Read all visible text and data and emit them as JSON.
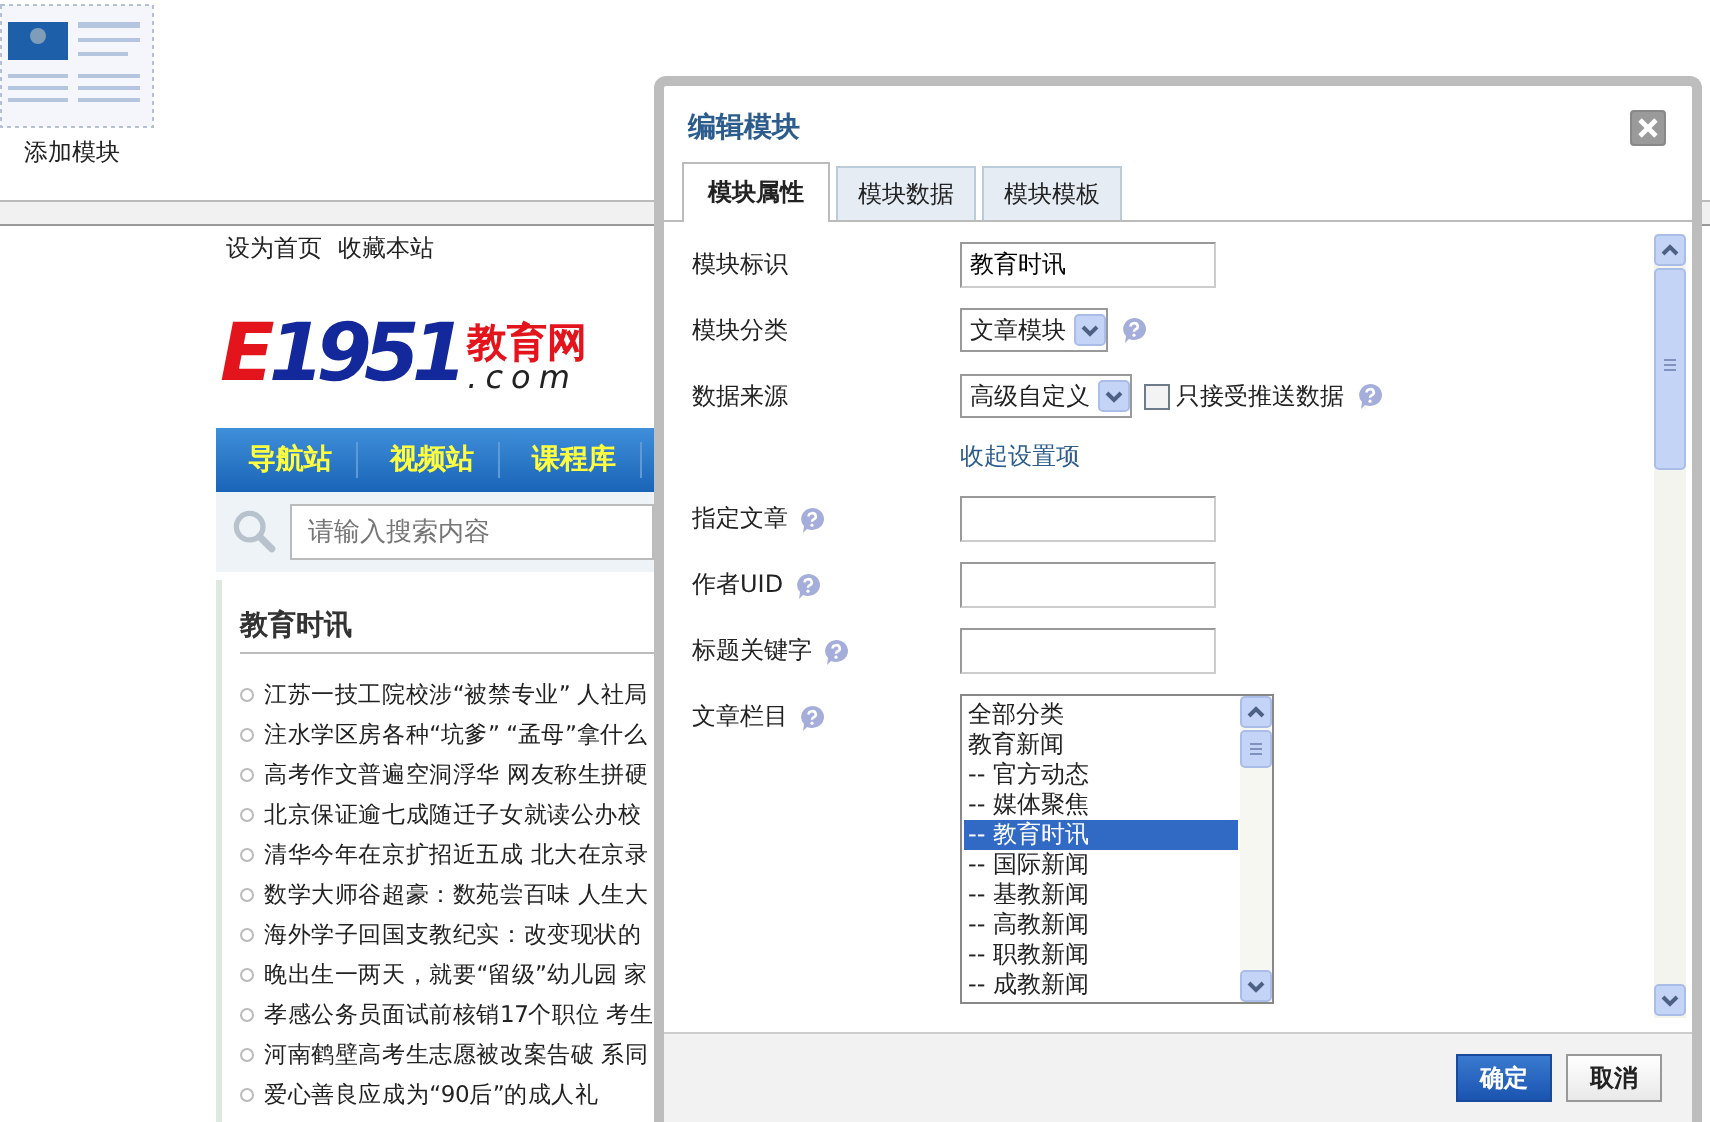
{
  "module_palette": {
    "label": "添加模块"
  },
  "site": {
    "top_links": [
      "设为首页",
      "收藏本站"
    ],
    "logo": {
      "letter": "E",
      "number": "1951",
      "name": "教育网",
      "domain": ".com"
    },
    "nav": [
      "导航站",
      "视频站",
      "课程库"
    ],
    "search": {
      "placeholder": "请输入搜索内容"
    },
    "news": {
      "title": "教育时讯",
      "items": [
        "江苏一技工院校涉“被禁专业” 人社局",
        "注水学区房各种“坑爹” “孟母”拿什么",
        "高考作文普遍空洞浮华 网友称生拼硬",
        "北京保证逾七成随迁子女就读公办校",
        "清华今年在京扩招近五成 北大在京录",
        "数学大师谷超豪：数苑尝百味 人生大",
        "海外学子回国支教纪实：改变现状的",
        "晚出生一两天，就要“留级”幼儿园 家",
        "孝感公务员面试前核销17个职位 考生",
        "河南鹤壁高考生志愿被改案告破 系同",
        "爱心善良应成为“90后”的成人礼"
      ]
    }
  },
  "dialog": {
    "title": "编辑模块",
    "tabs": [
      {
        "label": "模块属性",
        "selected": true
      },
      {
        "label": "模块数据",
        "selected": false
      },
      {
        "label": "模块模板",
        "selected": false
      }
    ],
    "fields": [
      {
        "kind": "text",
        "label": "模块标识",
        "value": "教育时讯",
        "help": false
      },
      {
        "kind": "select",
        "label": "模块分类",
        "value": "文章模块",
        "help": true
      },
      {
        "kind": "select",
        "label": "数据来源",
        "value": "高级自定义",
        "checkbox": {
          "label": "只接受推送数据",
          "checked": false
        },
        "help": true
      },
      {
        "kind": "link",
        "label": "收起设置项"
      },
      {
        "kind": "text",
        "label": "指定文章",
        "help": true
      },
      {
        "kind": "text",
        "label": "作者UID",
        "help": true
      },
      {
        "kind": "text",
        "label": "标题关键字",
        "help": true
      },
      {
        "kind": "list",
        "label": "文章栏目",
        "help": true,
        "options": [
          {
            "label": "全部分类",
            "selected": false
          },
          {
            "label": "教育新闻",
            "selected": false
          },
          {
            "label": "-- 官方动态",
            "selected": false
          },
          {
            "label": "-- 媒体聚焦",
            "selected": false
          },
          {
            "label": "-- 教育时讯",
            "selected": true
          },
          {
            "label": "-- 国际新闻",
            "selected": false
          },
          {
            "label": "-- 基教新闻",
            "selected": false
          },
          {
            "label": "-- 高教新闻",
            "selected": false
          },
          {
            "label": "-- 职教新闻",
            "selected": false
          },
          {
            "label": "-- 成教新闻",
            "selected": false
          }
        ]
      }
    ],
    "buttons": [
      {
        "label": "确定",
        "kind": "primary"
      },
      {
        "label": "取消",
        "kind": "secondary"
      }
    ]
  }
}
